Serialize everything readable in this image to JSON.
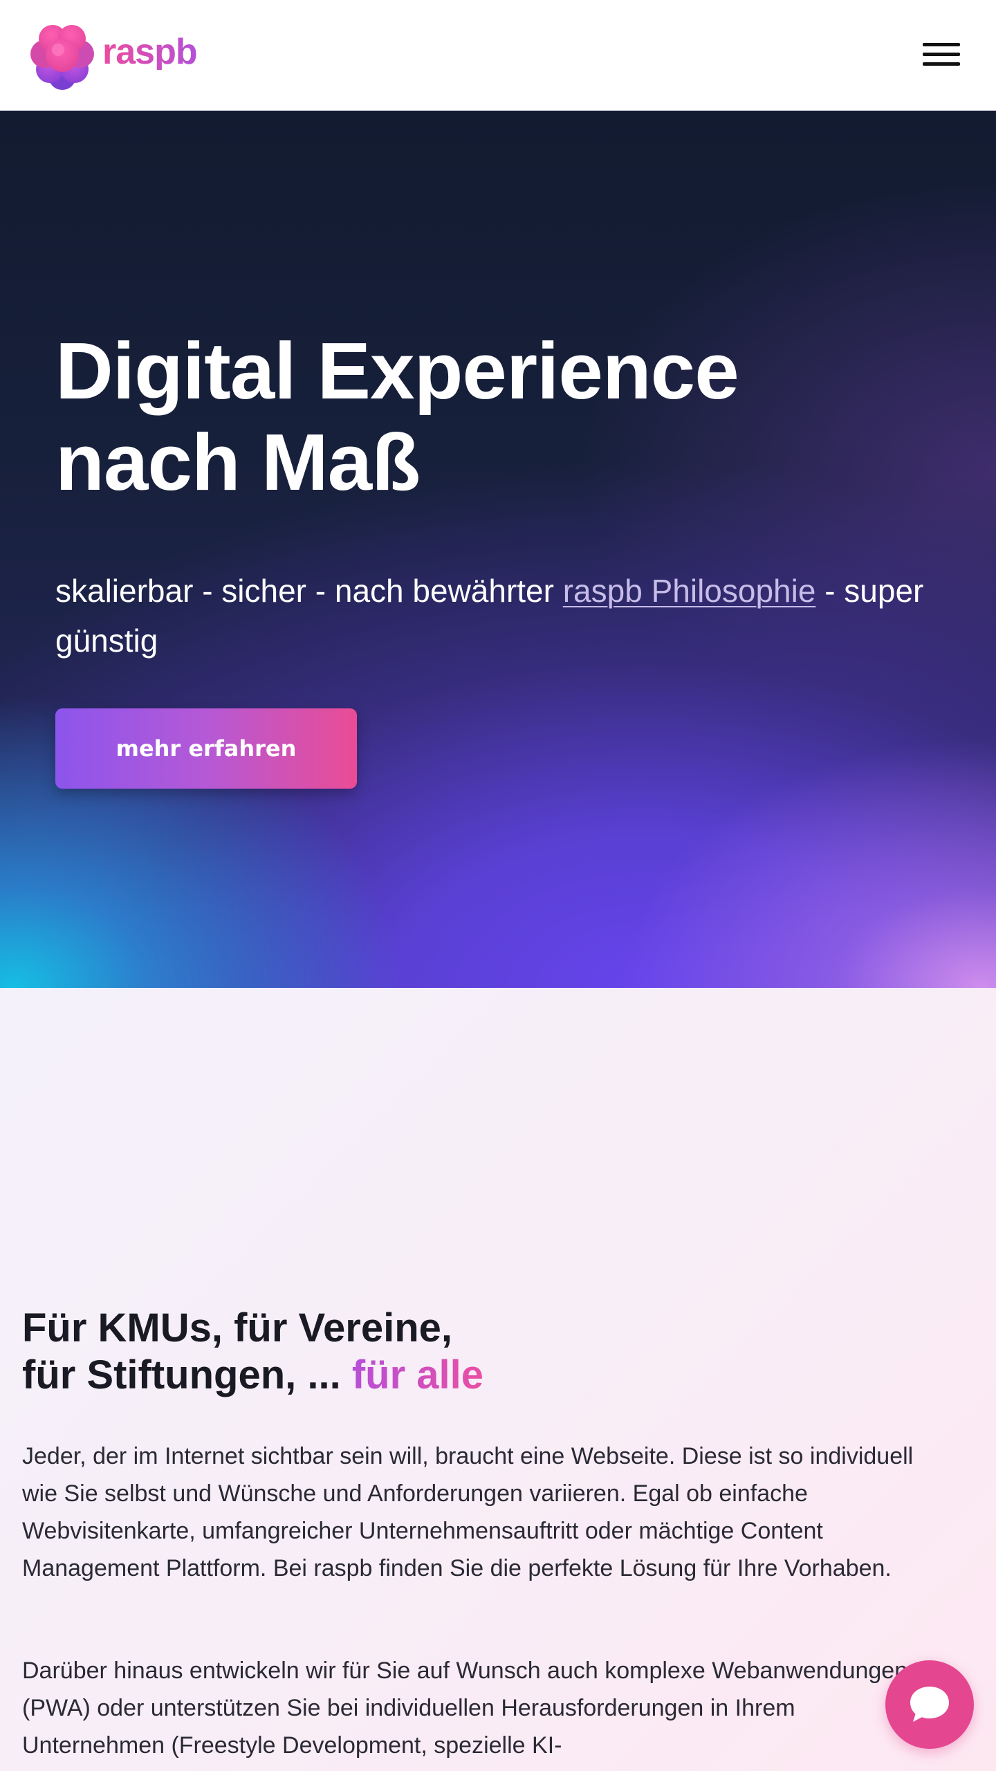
{
  "header": {
    "logo_text": "raspb",
    "logo_icon": "raspberry-logo-icon",
    "menu_icon": "hamburger-menu-icon"
  },
  "hero": {
    "title_line1": "Digital Experience",
    "title_line2": "nach Maß",
    "subtitle_before": "skalierbar - sicher - nach bewährter ",
    "subtitle_link": "raspb Philosophie",
    "subtitle_after": " - super günstig",
    "cta_label": "mehr erfahren"
  },
  "intro": {
    "title_line1": "Für KMUs, für Vereine,",
    "title_line2_start": "für Stiftungen, ... ",
    "title_highlight": "für alle",
    "paragraph_1": "Jeder, der im Internet sichtbar sein will, braucht eine Webseite. Diese ist so individuell wie Sie selbst und Wünsche und Anforderungen variieren. Egal ob einfache Webvisitenkarte, umfangreicher Unternehmensauftritt oder mächtige Content Management Plattform. Bei raspb finden Sie die perfekte Lösung für Ihre Vorhaben.",
    "paragraph_2": "Darüber hinaus entwickeln wir für Sie auf Wunsch auch komplexe Webanwendungen (PWA) oder unterstützen Sie bei individuellen Herausforderungen in Ihrem Unternehmen (Freestyle Development, spezielle KI-"
  },
  "chat": {
    "icon": "chat-bubble-icon"
  },
  "colors": {
    "brand_pink": "#e4468f",
    "brand_purple": "#8c55ec",
    "hero_dark": "#131b31",
    "header_bg": "#ffffff"
  }
}
